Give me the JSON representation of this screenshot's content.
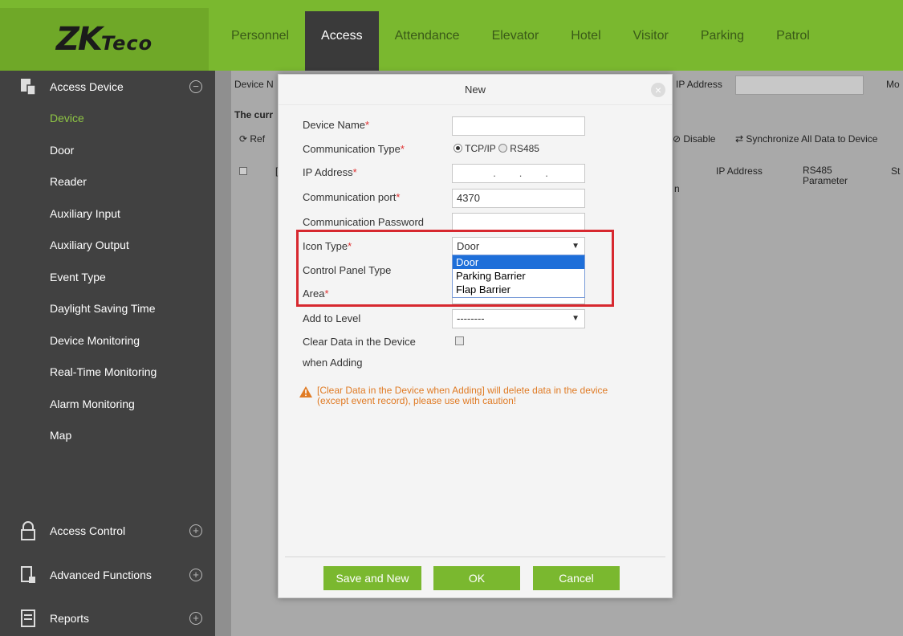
{
  "header": {
    "logo_main": "ZK",
    "logo_small": "Teco",
    "nav": [
      "Personnel",
      "Access",
      "Attendance",
      "Elevator",
      "Hotel",
      "Visitor",
      "Parking",
      "Patrol"
    ],
    "active_nav": "Access"
  },
  "sidebar": {
    "section": "Access Device",
    "items": [
      "Device",
      "Door",
      "Reader",
      "Auxiliary Input",
      "Auxiliary Output",
      "Event Type",
      "Daylight Saving Time",
      "Device Monitoring",
      "Real-Time Monitoring",
      "Alarm Monitoring",
      "Map"
    ],
    "active_item": "Device",
    "bottom_sections": [
      "Access Control",
      "Advanced Functions",
      "Reports"
    ]
  },
  "background": {
    "device_name_label": "Device N",
    "current_label": "The curr",
    "refresh_label": "Ref",
    "ip_label": "IP Address",
    "mo_label": "Mo",
    "disable_label": "Disable",
    "sync_label": "Synchronize All Data to Device",
    "col_ip": "IP Address",
    "col_rs485": "RS485",
    "col_rs485_2": "Parameter",
    "col_st": "St",
    "col_n": "n",
    "col_l": "["
  },
  "modal": {
    "title": "New",
    "close": "×",
    "device_name_label": "Device Name",
    "comm_type_label": "Communication Type",
    "comm_tcp": "TCP/IP",
    "comm_rs485": "RS485",
    "ip_label": "IP Address",
    "ip_value": ".        .        .",
    "port_label": "Communication port",
    "port_value": "4370",
    "password_label": "Communication Password",
    "icon_type_label": "Icon Type",
    "icon_type_value": "Door",
    "icon_options": [
      "Door",
      "Parking Barrier",
      "Flap Barrier"
    ],
    "control_panel_label": "Control Panel Type",
    "area_label": "Area",
    "level_label": "Add to Level",
    "level_value": "--------",
    "clear_label_1": "Clear Data in the Device",
    "clear_label_2": "when Adding",
    "warning_1": "[Clear Data in the Device when Adding] will delete data in the device",
    "warning_2": "(except event record), please use with caution!",
    "btn_save_new": "Save and New",
    "btn_ok": "OK",
    "btn_cancel": "Cancel"
  }
}
